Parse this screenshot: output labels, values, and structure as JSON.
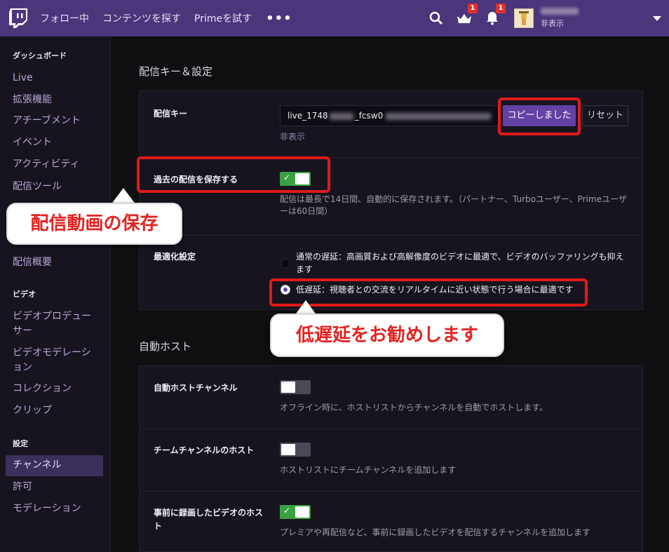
{
  "topbar": {
    "nav": [
      "フォロー中",
      "コンテンツを探す",
      "Primeを試す"
    ],
    "more": "•••",
    "prime_badge": "1",
    "notif_badge": "1",
    "user_status": "非表示"
  },
  "sidebar": {
    "dashboard_header": "ダッシュボード",
    "dashboard_items": [
      "Live",
      "拡張機能",
      "アチーブメント",
      "イベント",
      "アクティビティ",
      "配信ツール"
    ],
    "overview_item": "配信概要",
    "video_header": "ビデオ",
    "video_items": [
      "ビデオプロデューサー",
      "ビデオモデレーション",
      "コレクション",
      "クリップ"
    ],
    "settings_header": "設定",
    "settings_items": [
      "チャンネル",
      "許可",
      "モデレーション"
    ]
  },
  "stream_settings": {
    "title": "配信キー＆設定",
    "key_label": "配信キー",
    "key_prefix": "live_1748",
    "key_mid": "_fcsw0",
    "copy_button": "コピーしました",
    "reset_button": "リセット",
    "key_hidden": "非表示",
    "archive_label": "過去の配信を保存する",
    "archive_on": true,
    "archive_desc": "配信は最長で14日間、自動的に保存されます。（パートナー、Turboユーザー、Primeユーザーは60日間）",
    "optimize_label": "最適化設定",
    "normal_latency": "通常の遅延：高画質および高解像度のビデオに最適で、ビデオのバッファリングも抑えます",
    "low_latency": "低遅延：視聴者との交流をリアルタイムに近い状態で行う場合に最適です",
    "low_latency_selected": true
  },
  "auto_host": {
    "title": "自動ホスト",
    "rows": [
      {
        "label": "自動ホストチャンネル",
        "desc": "オフライン時に、ホストリストからチャンネルを自動でホストします。",
        "on": false
      },
      {
        "label": "チームチャンネルのホスト",
        "desc": "ホストリストにチームチャンネルを追加します",
        "on": false
      },
      {
        "label": "事前に録画したビデオのホスト",
        "desc": "プレミアや再配信など、事前に録画したビデオを配信するチャンネルを追加します",
        "on": true
      }
    ]
  },
  "annotations": {
    "save_callout": "配信動画の保存",
    "latency_callout": "低遅延をお勧めします"
  },
  "colors": {
    "brand": "#6441a4",
    "topbar": "#4b367c",
    "toggle_on": "#3aa142",
    "highlight": "#e01a1a"
  }
}
